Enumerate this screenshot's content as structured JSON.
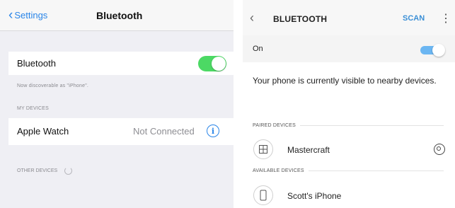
{
  "ios": {
    "back_label": "Settings",
    "nav_title": "Bluetooth",
    "bluetooth_label": "Bluetooth",
    "bluetooth_on": true,
    "discoverable_text": "Now discoverable as \"iPhone\".",
    "my_devices_header": "MY DEVICES",
    "devices": [
      {
        "name": "Apple Watch",
        "status": "Not Connected"
      }
    ],
    "other_devices_header": "OTHER DEVICES"
  },
  "android": {
    "title": "BLUETOOTH",
    "scan_label": "SCAN",
    "on_label": "On",
    "bluetooth_on": true,
    "visible_text": "Your phone is currently visible to nearby devices.",
    "paired_header": "PAIRED DEVICES",
    "paired_devices": [
      {
        "name": "Mastercraft",
        "icon": "speaker-icon"
      }
    ],
    "available_header": "AVAILABLE DEVICES",
    "available_devices": [
      {
        "name": "Scott's iPhone",
        "icon": "phone-icon"
      }
    ]
  },
  "colors": {
    "ios_accent": "#2a85e8",
    "ios_toggle_on": "#4cd964",
    "android_accent": "#3b8fd6",
    "android_toggle_on": "#6bb6f2"
  }
}
